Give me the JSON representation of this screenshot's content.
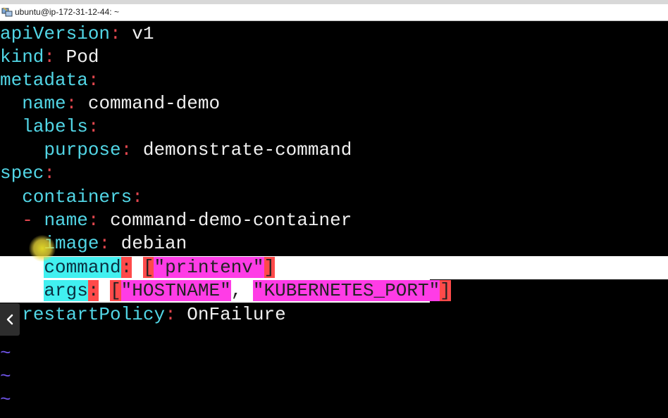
{
  "window": {
    "title": "ubuntu@ip-172-31-12-44: ~",
    "app_icon": "putty-icon"
  },
  "colors": {
    "background": "#000000",
    "key": "#52d6e6",
    "colon": "#e0464e",
    "value": "#f0f0f0",
    "tilde": "#6f54e8",
    "highlight_cyan": "#41f0f0",
    "highlight_red": "#ff4a4a",
    "highlight_magenta": "#ff3ce6"
  },
  "editor": {
    "lines": [
      {
        "indent": "",
        "key": "apiVersion",
        "value": " v1"
      },
      {
        "indent": "",
        "key": "kind",
        "value": " Pod"
      },
      {
        "indent": "",
        "key": "metadata",
        "value": ""
      },
      {
        "indent": "  ",
        "key": "name",
        "value": " command-demo"
      },
      {
        "indent": "  ",
        "key": "labels",
        "value": ""
      },
      {
        "indent": "    ",
        "key": "purpose",
        "value": " demonstrate-command"
      },
      {
        "indent": "",
        "key": "spec",
        "value": ""
      },
      {
        "indent": "  ",
        "key": "containers",
        "value": ""
      },
      {
        "indent": "  ",
        "dash": "- ",
        "key": "name",
        "value": " command-demo-container"
      },
      {
        "indent": "    ",
        "key": "image",
        "value": " debian"
      },
      {
        "indent": "    ",
        "key": "command",
        "bracket_open": "[",
        "value": "\"printenv\"",
        "bracket_close": "]"
      },
      {
        "indent": "    ",
        "key": "args",
        "bracket_open": "[",
        "value1": "\"HOSTNAME\"",
        "comma": ",",
        "value2": "\"KUBERNETES_PORT\"",
        "bracket_close": "]"
      },
      {
        "indent": "  ",
        "key": "restartPolicy",
        "value": " OnFailure"
      }
    ],
    "colon": ":",
    "empty_line_marker": "~",
    "empty_lines": 3
  },
  "side_button": {
    "icon": "chevron-left-icon"
  }
}
